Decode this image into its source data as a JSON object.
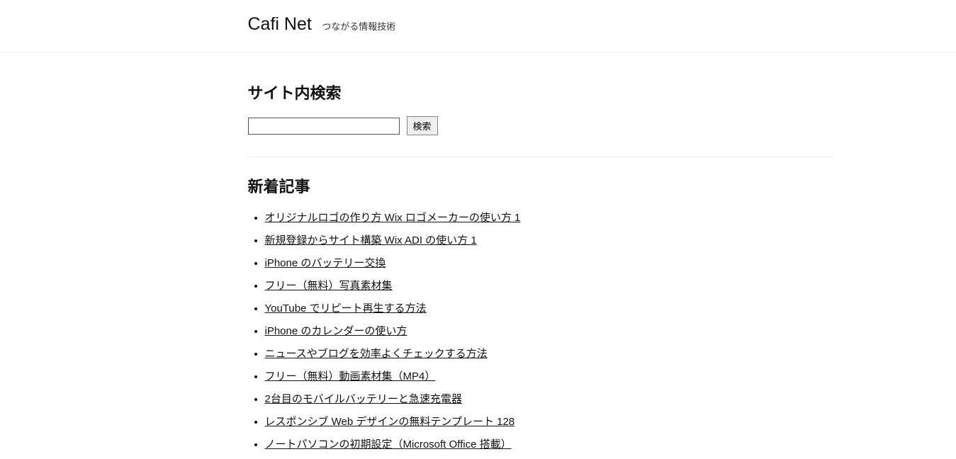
{
  "header": {
    "site_title": "Cafi Net",
    "tagline": "つながる情報技術"
  },
  "search": {
    "heading": "サイト内検索",
    "input_value": "",
    "button_label": "検索"
  },
  "recent": {
    "heading": "新着記事",
    "articles": [
      "オリジナルロゴの作り方 Wix ロゴメーカーの使い方 1",
      "新規登録からサイト構築 Wix ADI の使い方 1",
      "iPhone のバッテリー交換",
      "フリー（無料）写真素材集",
      "YouTube でリピート再生する方法",
      "iPhone のカレンダーの使い方",
      "ニュースやブログを効率よくチェックする方法",
      "フリー（無料）動画素材集（MP4）",
      "2台目のモバイルバッテリーと急速充電器",
      "レスポンシブ Web デザインの無料テンプレート 128",
      "ノートパソコンの初期設定（Microsoft Office 搭載）"
    ]
  }
}
